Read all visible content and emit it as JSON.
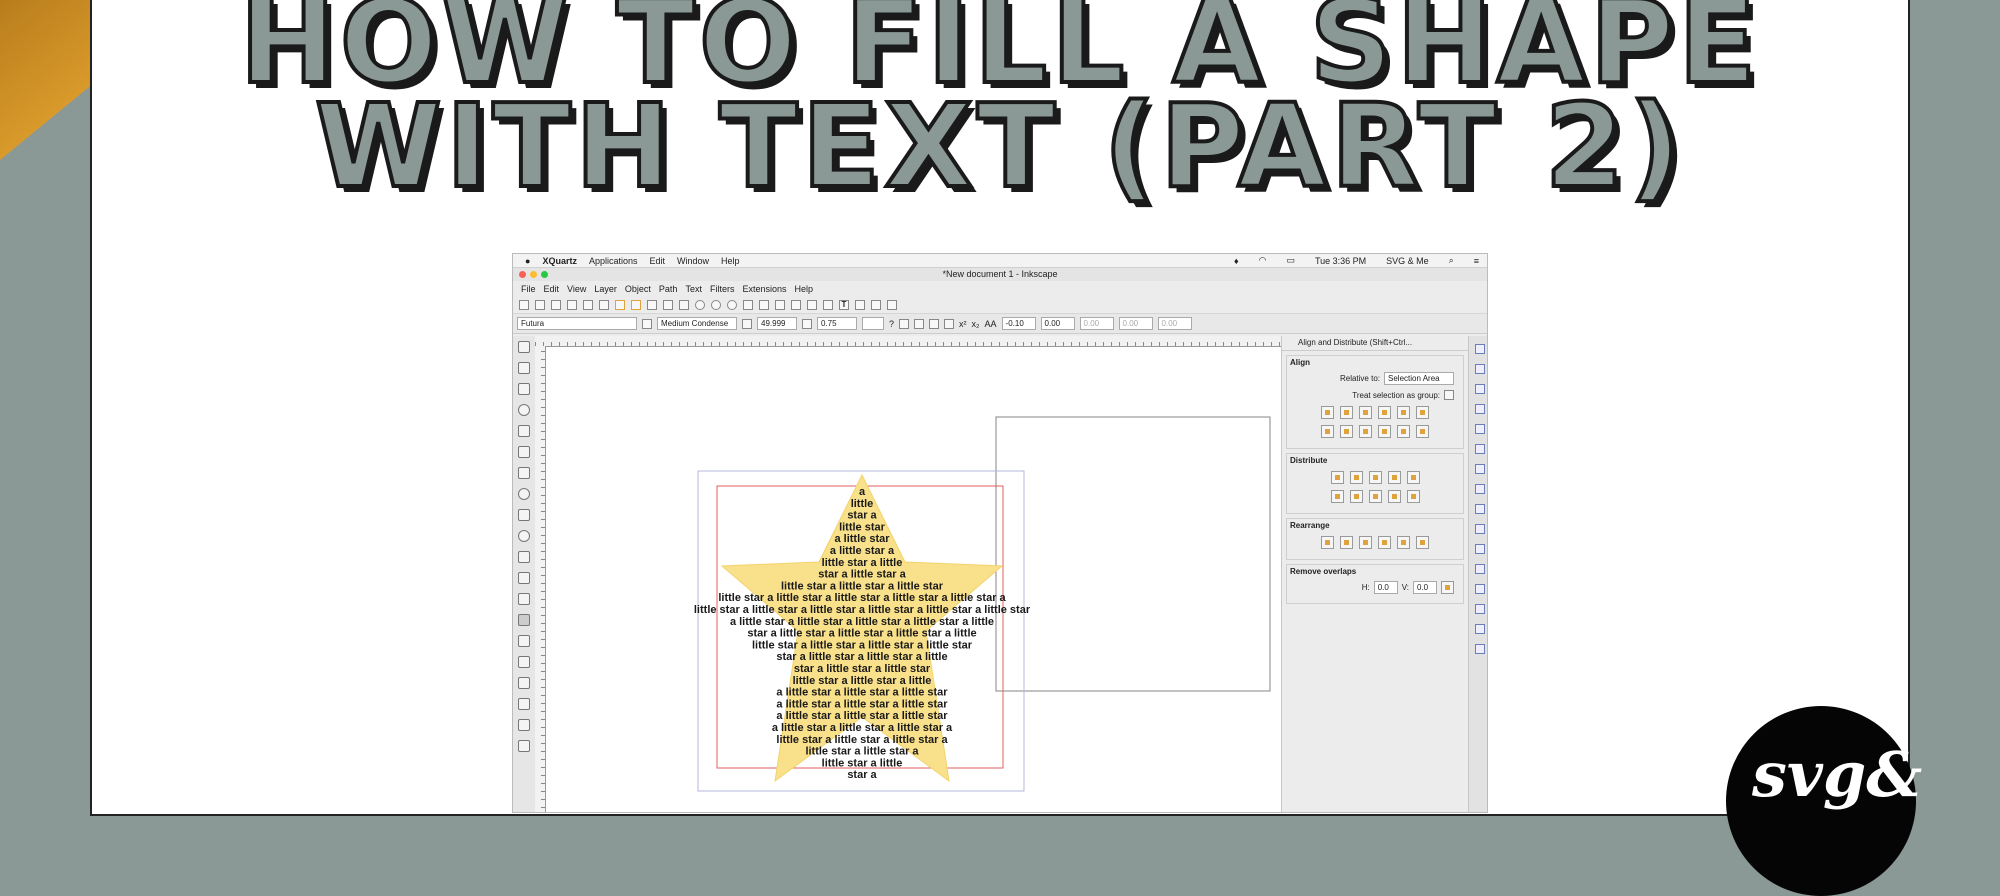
{
  "title": {
    "line1": "HOW TO FILL A SHAPE",
    "line2": "WITH TEXT (PART 2)"
  },
  "colors": {
    "background": "#8a9996",
    "accent_gold": "#d99a2b",
    "star_fill": "#f9e08a"
  },
  "mac": {
    "apple": "",
    "items": [
      "XQuartz",
      "Applications",
      "Edit",
      "Window",
      "Help"
    ],
    "clock": "Tue 3:36 PM",
    "user": "SVG & Me"
  },
  "window_title": "*New document 1 - Inkscape",
  "menu": [
    "File",
    "Edit",
    "View",
    "Layer",
    "Object",
    "Path",
    "Text",
    "Filters",
    "Extensions",
    "Help"
  ],
  "text_toolbar": {
    "font_family": "Futura",
    "font_style": "Medium Condense",
    "font_size": "49.999",
    "line_spacing": "0.75",
    "letter_spacing": "-0.10",
    "word_spacing": "0.00",
    "kerning": "0.00",
    "vertical_shift": "0.00",
    "rotation": "0.00"
  },
  "panel": {
    "header": "Align and Distribute (Shift+Ctrl...",
    "align_title": "Align",
    "relative_label": "Relative to:",
    "relative_value": "Selection Area",
    "treat_group": "Treat selection as group:",
    "distribute_title": "Distribute",
    "rearrange_title": "Rearrange",
    "overlaps_title": "Remove overlaps",
    "h_label": "H:",
    "h_value": "0.0",
    "v_label": "V:",
    "v_value": "0.0"
  },
  "star_text_lines": [
    "a",
    "little",
    "star a",
    "little star",
    "a little star",
    "a little star a",
    "little star a little",
    "star a little star a",
    "little star a little star a little star",
    "little star a little star a little star a little star a little star a",
    "little star a little star a little star a little star a little star a little star",
    "a little star a little star a little star a little star a little",
    "star a little star a little star a little star a little",
    "little star a little star a little star a little star",
    "star a little star a little star a little",
    "star a little star a little star",
    "little star a little star a little",
    "a little star a little star a little star",
    "a little star a little star a little star",
    "a little star a little star a little star",
    "a little star a little star a little star a",
    "little star a little star a little star a",
    "little star a   little star a",
    "little star      a little",
    "star a"
  ],
  "logo_text": "svg&"
}
